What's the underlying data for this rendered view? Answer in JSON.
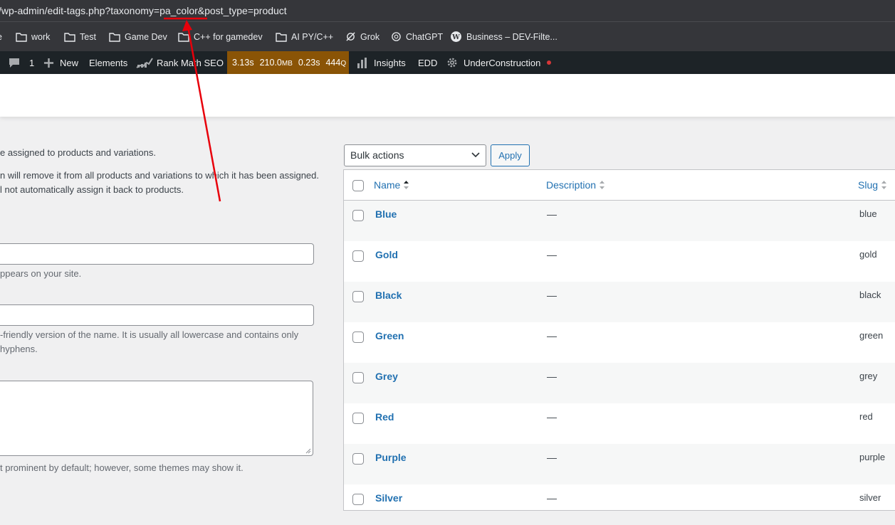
{
  "browser": {
    "url": "/wp-admin/edit-tags.php?taxonomy=pa_color&post_type=product"
  },
  "bookmarks": [
    {
      "label": "work",
      "icon": "folder-icon"
    },
    {
      "label": "Test",
      "icon": "folder-icon"
    },
    {
      "label": "Game Dev",
      "icon": "folder-icon"
    },
    {
      "label": "C++ for gamedev",
      "icon": "folder-icon"
    },
    {
      "label": "AI PY/C++",
      "icon": "folder-icon"
    },
    {
      "label": "Grok",
      "icon": "grok-icon"
    },
    {
      "label": "ChatGPT",
      "icon": "chatgpt-icon"
    },
    {
      "label": "Business – DEV-Filte...",
      "icon": "wordpress-icon"
    }
  ],
  "adminbar": {
    "comments_count": "1",
    "new_label": "New",
    "elements_label": "Elements",
    "rankmath_label": "Rank Math SEO",
    "perf": {
      "time": "3.13s",
      "memory": "210.0",
      "memory_unit": "MB",
      "db_time": "0.23s",
      "queries": "444",
      "queries_unit": "Q"
    },
    "insights_label": "Insights",
    "edd_label": "EDD",
    "underconstruction_label": "UnderConstruction",
    "status_color": "#d63638"
  },
  "form": {
    "intro_line1": "e assigned to products and variations.",
    "intro_line2": "n will remove it from all products and variations to which it has been assigned.",
    "intro_line3": "l not automatically assign it back to products.",
    "name_hint": "ppears on your site.",
    "slug_hint_line1": "-friendly version of the name. It is usually all lowercase and contains only",
    "slug_hint_line2": " hyphens.",
    "description_hint": "t prominent by default; however, some themes may show it."
  },
  "bulk": {
    "selected": "Bulk actions",
    "apply_label": "Apply"
  },
  "table": {
    "columns": {
      "name": "Name",
      "description": "Description",
      "slug": "Slug"
    },
    "rows": [
      {
        "name": "Blue",
        "description": "—",
        "slug": "blue"
      },
      {
        "name": "Gold",
        "description": "—",
        "slug": "gold"
      },
      {
        "name": "Black",
        "description": "—",
        "slug": "black"
      },
      {
        "name": "Green",
        "description": "—",
        "slug": "green"
      },
      {
        "name": "Grey",
        "description": "—",
        "slug": "grey"
      },
      {
        "name": "Red",
        "description": "—",
        "slug": "red"
      },
      {
        "name": "Purple",
        "description": "—",
        "slug": "purple"
      },
      {
        "name": "Silver",
        "description": "—",
        "slug": "silver"
      }
    ]
  },
  "annotation": {
    "color": "#e8000b"
  },
  "colors": {
    "link": "#2271b1",
    "adminbar": "#1d2327",
    "perf": "#8a5406"
  }
}
